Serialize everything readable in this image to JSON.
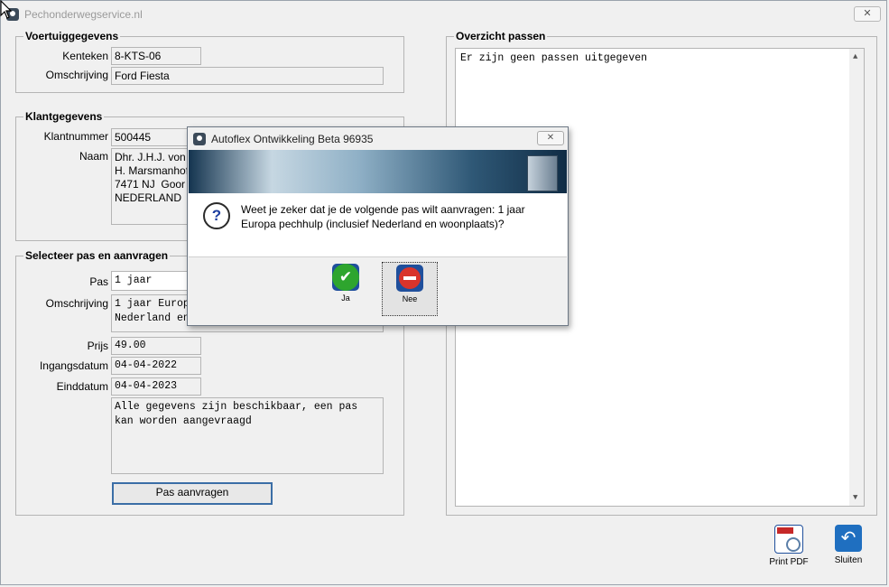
{
  "window": {
    "title": "Pechonderwegservice.nl",
    "close": "✕"
  },
  "vehicle": {
    "legend": "Voertuiggegevens",
    "plate_label": "Kenteken",
    "plate": "8-KTS-06",
    "desc_label": "Omschrijving",
    "desc": "Ford Fiesta"
  },
  "customer": {
    "legend": "Klantgegevens",
    "number_label": "Klantnummer",
    "number": "500445",
    "name_label": "Naam",
    "name_lines": "Dhr. J.H.J. von\nH. Marsmanhof\n7471 NJ  Goor\nNEDERLAND"
  },
  "pass": {
    "legend": "Selecteer pas en aanvragen",
    "pass_label": "Pas",
    "pass_value": "1 jaar",
    "desc_label": "Omschrijving",
    "desc": "1 jaar Europ\nNederland en",
    "price_label": "Prijs",
    "price": "49.00",
    "start_label": "Ingangsdatum",
    "start": "04-04-2022",
    "end_label": "Einddatum",
    "end": "04-04-2023",
    "status": "Alle gegevens zijn beschikbaar, een pas\nkan worden aangevraagd",
    "request_button": "Pas aanvragen"
  },
  "overview": {
    "legend": "Overzicht passen",
    "text": "Er zijn geen passen uitgegeven"
  },
  "toolbar": {
    "print": "Print PDF",
    "close": "Sluiten"
  },
  "dialog": {
    "title": "Autoflex Ontwikkeling Beta 96935",
    "close": "✕",
    "message": "Weet je zeker dat je de volgende pas wilt aanvragen: 1 jaar Europa pechhulp (inclusief Nederland en woonplaats)?",
    "yes": "Ja",
    "no": "Nee"
  }
}
